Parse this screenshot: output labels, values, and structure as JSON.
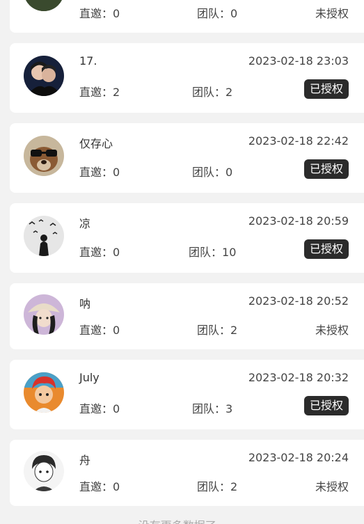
{
  "labels": {
    "direct": "直邀：",
    "team": "团队："
  },
  "members": [
    {
      "name": "",
      "time": "",
      "direct": "0",
      "team": "0",
      "status": "未授权",
      "authorized": false,
      "avatar_icon": "avatar-landscape-icon"
    },
    {
      "name": "17.",
      "time": "2023-02-18 23:03",
      "direct": "2",
      "team": "2",
      "status": "已授权",
      "authorized": true,
      "avatar_icon": "avatar-couple-icon"
    },
    {
      "name": "仅存心",
      "time": "2023-02-18 22:42",
      "direct": "0",
      "team": "0",
      "status": "已授权",
      "authorized": true,
      "avatar_icon": "avatar-dog-sunglasses-icon"
    },
    {
      "name": "凉",
      "time": "2023-02-18 20:59",
      "direct": "0",
      "team": "10",
      "status": "已授权",
      "authorized": true,
      "avatar_icon": "avatar-birds-icon"
    },
    {
      "name": "呐",
      "time": "2023-02-18 20:52",
      "direct": "0",
      "team": "2",
      "status": "未授权",
      "authorized": false,
      "avatar_icon": "avatar-girl-hat-icon"
    },
    {
      "name": "July",
      "time": "2023-02-18 20:32",
      "direct": "0",
      "team": "3",
      "status": "已授权",
      "authorized": true,
      "avatar_icon": "avatar-cartoon-boy-icon"
    },
    {
      "name": "舟",
      "time": "2023-02-18 20:24",
      "direct": "0",
      "team": "2",
      "status": "未授权",
      "authorized": false,
      "avatar_icon": "avatar-sketch-boy-icon"
    }
  ],
  "footer": "没有更多数据了~"
}
